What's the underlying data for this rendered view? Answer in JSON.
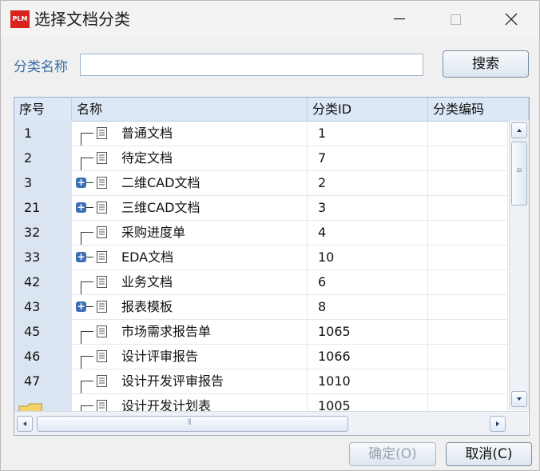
{
  "window": {
    "logo_text": "PLM",
    "title": "选择文档分类"
  },
  "search": {
    "label": "分类名称",
    "value": "",
    "placeholder": "",
    "button_label": "搜索"
  },
  "table": {
    "columns": [
      "序号",
      "名称",
      "分类ID",
      "分类编码"
    ],
    "rows": [
      {
        "seq": "1",
        "name": "普通文档",
        "id": "1",
        "code": "",
        "expandable": false
      },
      {
        "seq": "2",
        "name": "待定文档",
        "id": "7",
        "code": "",
        "expandable": false
      },
      {
        "seq": "3",
        "name": "二维CAD文档",
        "id": "2",
        "code": "",
        "expandable": true
      },
      {
        "seq": "21",
        "name": "三维CAD文档",
        "id": "3",
        "code": "",
        "expandable": true
      },
      {
        "seq": "32",
        "name": "采购进度单",
        "id": "4",
        "code": "",
        "expandable": false
      },
      {
        "seq": "33",
        "name": "EDA文档",
        "id": "10",
        "code": "",
        "expandable": true
      },
      {
        "seq": "42",
        "name": "业务文档",
        "id": "6",
        "code": "",
        "expandable": false
      },
      {
        "seq": "43",
        "name": "报表模板",
        "id": "8",
        "code": "",
        "expandable": true
      },
      {
        "seq": "45",
        "name": "市场需求报告单",
        "id": "1065",
        "code": "",
        "expandable": false
      },
      {
        "seq": "46",
        "name": "设计评审报告",
        "id": "1066",
        "code": "",
        "expandable": false
      },
      {
        "seq": "47",
        "name": "设计开发评审报告",
        "id": "1010",
        "code": "",
        "expandable": false
      },
      {
        "seq": "",
        "name": "设计开发计划表",
        "id": "1005",
        "code": "",
        "expandable": false
      }
    ]
  },
  "footer": {
    "ok_label": "确定(O)",
    "cancel_label": "取消(C)"
  },
  "colors": {
    "logo_red": "#d9231d",
    "label_blue": "#3a6ea5",
    "header_bg": "#dce8f5",
    "seq_bg": "#dbe5f1"
  }
}
